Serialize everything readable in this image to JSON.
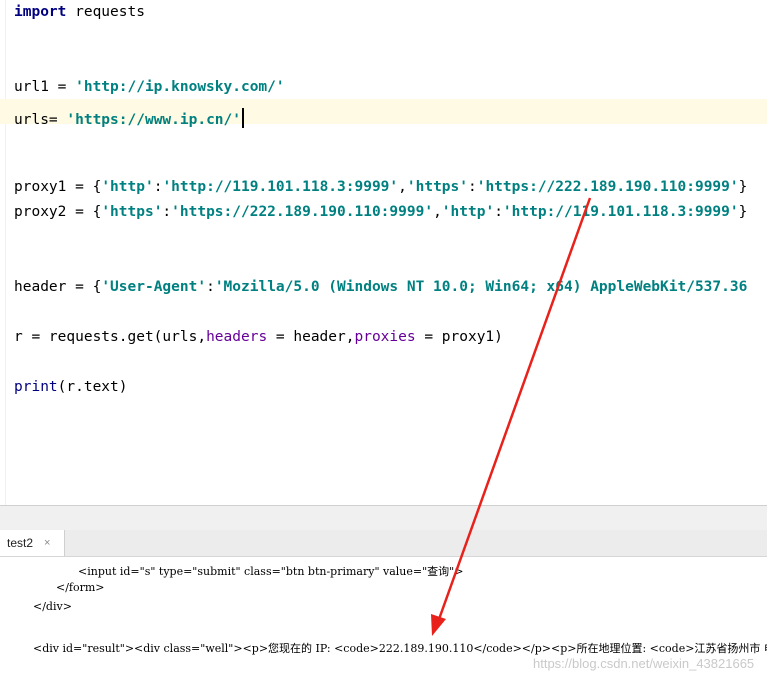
{
  "editor": {
    "line1": {
      "kw": "import",
      "rest": " requests"
    },
    "line2": {
      "lhs": "url1 = ",
      "val": "'http://ip.knowsky.com/'"
    },
    "line3": {
      "lhs": "urls= ",
      "val": "'https://www.ip.cn/'"
    },
    "line4": {
      "lhs": "proxy1 = {",
      "k1": "'http'",
      "c1": ":",
      "v1": "'http://119.101.118.3:9999'",
      "sep": ",",
      "k2": "'https'",
      "c2": ":",
      "v2": "'https://222.189.190.110:9999'",
      "end": "}"
    },
    "line5": {
      "lhs": "proxy2 = {",
      "k1": "'https'",
      "c1": ":",
      "v1": "'https://222.189.190.110:9999'",
      "sep": ",",
      "k2": "'http'",
      "c2": ":",
      "v2": "'http://119.101.118.3:9999'",
      "end": "}"
    },
    "line6": {
      "lhs": "header = {",
      "k1": "'User-Agent'",
      "c1": ":",
      "v1": "'Mozilla/5.0 (Windows NT 10.0; Win64; x64) AppleWebKit/537.36"
    },
    "line7": {
      "a": "r = requests.get(urls,",
      "p1": "headers",
      "b": " = header,",
      "p2": "proxies",
      "c": " = proxy1)"
    },
    "line8": {
      "fn": "print",
      "rest": "(r.text)"
    }
  },
  "run_panel": {
    "tab_label": "test2",
    "tab_close": "×",
    "output_lines": [
      "<input id=\"s\" type=\"submit\" class=\"btn btn-primary\" value=\"查询\">",
      "</form>",
      "</div>",
      "<div id=\"result\"><div class=\"well\"><p>您现在的 IP: <code>222.189.190.110</code></p><p>所在地理位置: <code>江苏省扬州市 电信"
    ]
  },
  "watermark": "https://blog.csdn.net/weixin_43821665",
  "colors": {
    "annotation_arrow": "#e8211a",
    "keyword": "#000080",
    "string": "#008080",
    "param": "#660099"
  }
}
